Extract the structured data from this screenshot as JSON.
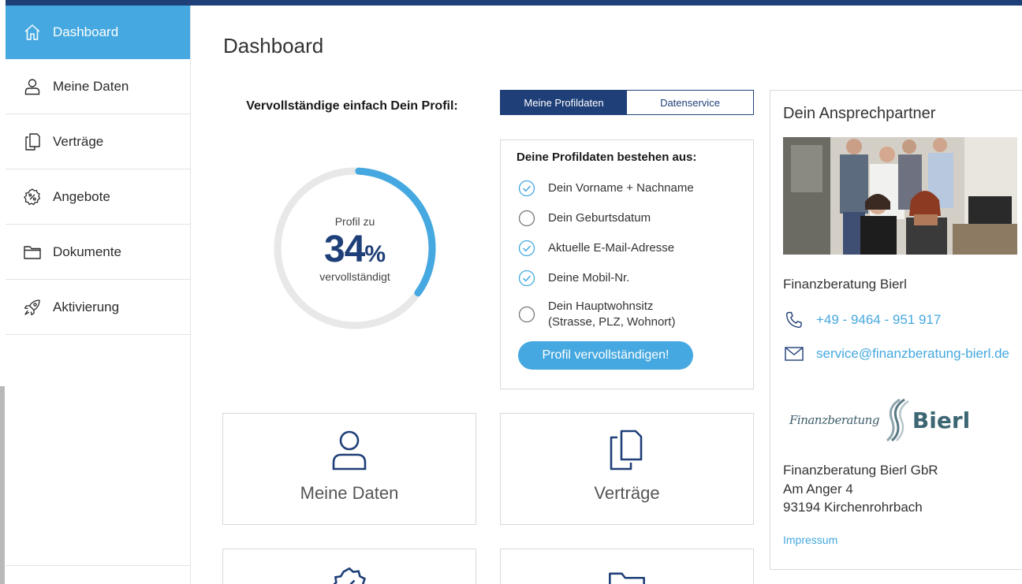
{
  "sidebar": {
    "items": [
      {
        "label": "Dashboard",
        "icon": "home-icon",
        "active": true
      },
      {
        "label": "Meine Daten",
        "icon": "user-icon",
        "active": false
      },
      {
        "label": "Verträge",
        "icon": "documents-icon",
        "active": false
      },
      {
        "label": "Angebote",
        "icon": "percent-badge-icon",
        "active": false
      },
      {
        "label": "Dokumente",
        "icon": "folder-icon",
        "active": false
      },
      {
        "label": "Aktivierung",
        "icon": "rocket-icon",
        "active": false
      }
    ]
  },
  "page": {
    "title": "Dashboard"
  },
  "profile": {
    "heading": "Vervollständige einfach Dein Profil:",
    "ring_pre": "Profil zu",
    "percent": "34",
    "percent_symbol": "%",
    "percent_value": 34,
    "ring_post": "vervollständigt"
  },
  "tabs": [
    {
      "label": "Meine Profildaten",
      "selected": true
    },
    {
      "label": "Datenservice",
      "selected": false
    }
  ],
  "checklist": {
    "title": "Deine Profildaten bestehen aus:",
    "items": [
      {
        "text": "Dein Vorname + Nachname",
        "done": true
      },
      {
        "text": "Dein Geburtsdatum",
        "done": false
      },
      {
        "text": "Aktuelle E-Mail-Adresse",
        "done": true
      },
      {
        "text": "Deine Mobil-Nr.",
        "done": true
      },
      {
        "text": "Dein Hauptwohnsitz",
        "text2": "(Strasse, PLZ, Wohnort)",
        "done": false
      }
    ],
    "button": "Profil vervollständigen!"
  },
  "tiles": [
    {
      "label": "Meine Daten",
      "icon": "user-icon"
    },
    {
      "label": "Verträge",
      "icon": "documents-icon"
    },
    {
      "label": "",
      "icon": "percent-badge-icon"
    },
    {
      "label": "",
      "icon": "folder-icon"
    }
  ],
  "contact": {
    "title": "Dein Ansprechpartner",
    "company": "Finanzberatung Bierl",
    "phone": "+49 - 9464 - 951 917",
    "email": "service@finanzberatung-bierl.de",
    "logo_small": "Finanzberatung",
    "logo_big": "Bierl",
    "address": [
      "Finanzberatung Bierl GbR",
      "Am Anger 4",
      "93194 Kirchenrohrbach"
    ],
    "impressum": "Impressum"
  },
  "colors": {
    "accent": "#45a8e0",
    "navy": "#1f3f78",
    "ring_track": "#e8e8e8"
  }
}
